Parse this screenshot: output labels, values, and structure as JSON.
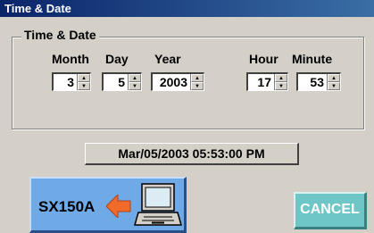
{
  "window": {
    "title": "Time & Date"
  },
  "group": {
    "legend": "Time & Date"
  },
  "fields": {
    "month": {
      "label": "Month",
      "value": "3"
    },
    "day": {
      "label": "Day",
      "value": "5"
    },
    "year": {
      "label": "Year",
      "value": "2003"
    },
    "hour": {
      "label": "Hour",
      "value": "17"
    },
    "minute": {
      "label": "Minute",
      "value": "53"
    }
  },
  "status": {
    "datetime": "Mar/05/2003  05:53:00 PM"
  },
  "buttons": {
    "sx150a_label": "SX150A",
    "cancel_label": "CANCEL"
  },
  "colors": {
    "sx_button_bg": "#6fa9e6",
    "cancel_button_bg": "#6ec6c6",
    "arrow": "#f06a2a"
  },
  "icons": {
    "arrow": "arrow-left-icon",
    "computer": "laptop-computer-icon"
  }
}
